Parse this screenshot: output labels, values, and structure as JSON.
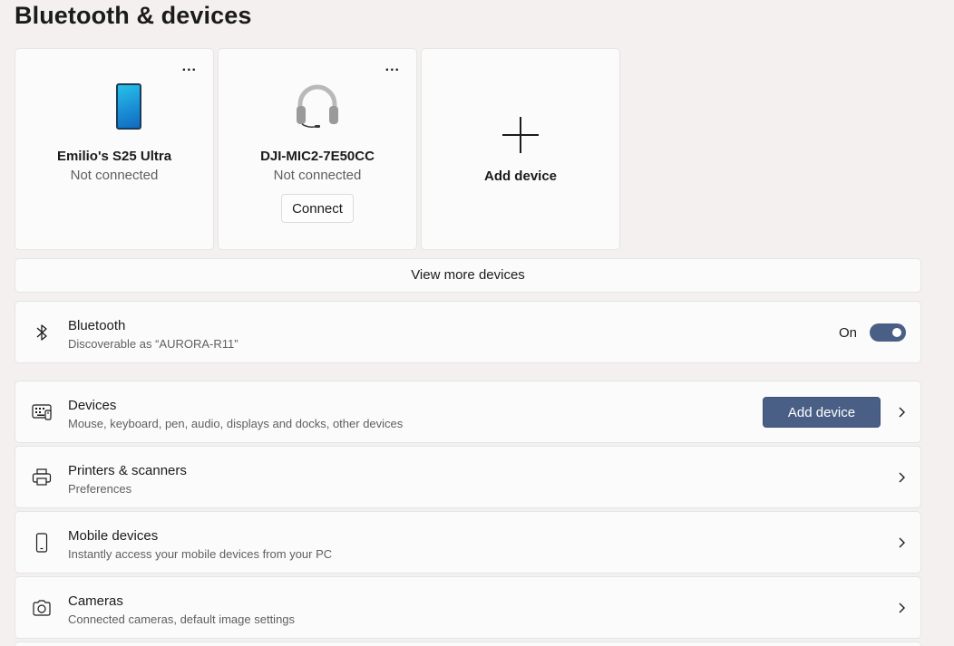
{
  "page": {
    "title": "Bluetooth & devices"
  },
  "cards": [
    {
      "name": "Emilio's S25 Ultra",
      "status": "Not connected",
      "more": "..."
    },
    {
      "name": "DJI-MIC2-7E50CC",
      "status": "Not connected",
      "more": "...",
      "connect_label": "Connect"
    },
    {
      "label": "Add device"
    }
  ],
  "view_more": "View more devices",
  "bluetooth": {
    "title": "Bluetooth",
    "subtitle": "Discoverable as “AURORA-R11”",
    "toggle_label": "On",
    "toggle_on": true
  },
  "settings": [
    {
      "title": "Devices",
      "subtitle": "Mouse, keyboard, pen, audio, displays and docks, other devices",
      "button": "Add device",
      "icon": "keyboard-icon"
    },
    {
      "title": "Printers & scanners",
      "subtitle": "Preferences",
      "icon": "printer-icon"
    },
    {
      "title": "Mobile devices",
      "subtitle": "Instantly access your mobile devices from your PC",
      "icon": "phone-outline-icon"
    },
    {
      "title": "Cameras",
      "subtitle": "Connected cameras, default image settings",
      "icon": "camera-icon"
    }
  ],
  "colors": {
    "accent": "#4a5f86",
    "background": "#f3f0ef",
    "card": "#fbfbfb"
  }
}
